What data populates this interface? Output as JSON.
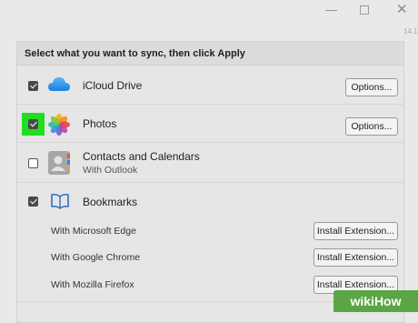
{
  "window": {
    "minimize_glyph": "—",
    "close_glyph": "✕",
    "version_text": "14.1"
  },
  "header": {
    "instruction": "Select what you want to sync, then click Apply"
  },
  "items": [
    {
      "label": "iCloud Drive",
      "checked": true,
      "button": "Options...",
      "icon": "cloud-icon"
    },
    {
      "label": "Photos",
      "checked": true,
      "button": "Options...",
      "icon": "photos-icon"
    },
    {
      "label": "Contacts and Calendars",
      "sublabel": "With Outlook",
      "checked": false,
      "icon": "contacts-icon"
    },
    {
      "label": "Bookmarks",
      "checked": true,
      "icon": "book-icon",
      "browsers": [
        {
          "label": "With Microsoft Edge",
          "button": "Install Extension..."
        },
        {
          "label": "With Google Chrome",
          "button": "Install Extension..."
        },
        {
          "label": "With Mozilla Firefox",
          "button": "Install Extension..."
        }
      ]
    }
  ],
  "watermark": "wikiHow"
}
